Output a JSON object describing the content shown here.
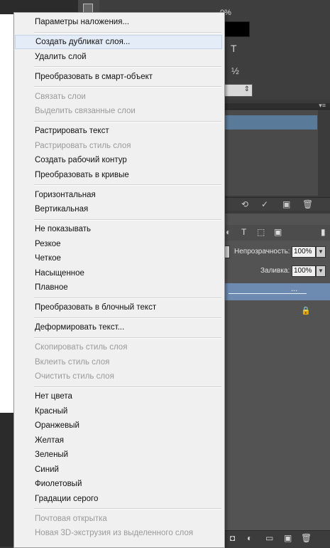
{
  "top_panel": {
    "percent_text": "0%",
    "glyph_text": "T",
    "glyph_half": "½"
  },
  "layers_panel": {
    "opacity_label": "Непрозрачность:",
    "opacity_value": "100%",
    "fill_label": "Заливка:",
    "fill_value": "100%",
    "selected_layer_suffix": "..."
  },
  "menu": {
    "items": [
      {
        "label": "Параметры наложения...",
        "enabled": true
      },
      {
        "label": "Создать дубликат слоя...",
        "enabled": true,
        "highlighted": true
      },
      {
        "label": "Удалить слой",
        "enabled": true
      },
      {
        "label": "Преобразовать в смарт-объект",
        "enabled": true
      },
      {
        "label": "Связать слои",
        "enabled": false
      },
      {
        "label": "Выделить связанные слои",
        "enabled": false
      },
      {
        "label": "Растрировать текст",
        "enabled": true
      },
      {
        "label": "Растрировать стиль слоя",
        "enabled": false
      },
      {
        "label": "Создать рабочий контур",
        "enabled": true
      },
      {
        "label": "Преобразовать в кривые",
        "enabled": true
      },
      {
        "label": "Горизонтальная",
        "enabled": true
      },
      {
        "label": "Вертикальная",
        "enabled": true
      },
      {
        "label": "Не показывать",
        "enabled": true
      },
      {
        "label": "Резкое",
        "enabled": true
      },
      {
        "label": "Четкое",
        "enabled": true
      },
      {
        "label": "Насыщенное",
        "enabled": true
      },
      {
        "label": "Плавное",
        "enabled": true
      },
      {
        "label": "Преобразовать в блочный текст",
        "enabled": true
      },
      {
        "label": "Деформировать текст...",
        "enabled": true
      },
      {
        "label": "Скопировать стиль слоя",
        "enabled": false
      },
      {
        "label": "Вклеить стиль слоя",
        "enabled": false
      },
      {
        "label": "Очистить стиль слоя",
        "enabled": false
      },
      {
        "label": "Нет цвета",
        "enabled": true
      },
      {
        "label": "Красный",
        "enabled": true
      },
      {
        "label": "Оранжевый",
        "enabled": true
      },
      {
        "label": "Желтая",
        "enabled": true
      },
      {
        "label": "Зеленый",
        "enabled": true
      },
      {
        "label": "Синий",
        "enabled": true
      },
      {
        "label": "Фиолетовый",
        "enabled": true
      },
      {
        "label": "Градации серого",
        "enabled": true
      },
      {
        "label": "Почтовая открытка",
        "enabled": false
      },
      {
        "label": "Новая 3D-экструзия из выделенного слоя",
        "enabled": false
      }
    ]
  },
  "colors": {
    "menu_bg": "#f0f0f0",
    "highlight": "#e3ecf7",
    "disabled_text": "#9a9a9a",
    "selected_layer": "#6d8ab0"
  }
}
